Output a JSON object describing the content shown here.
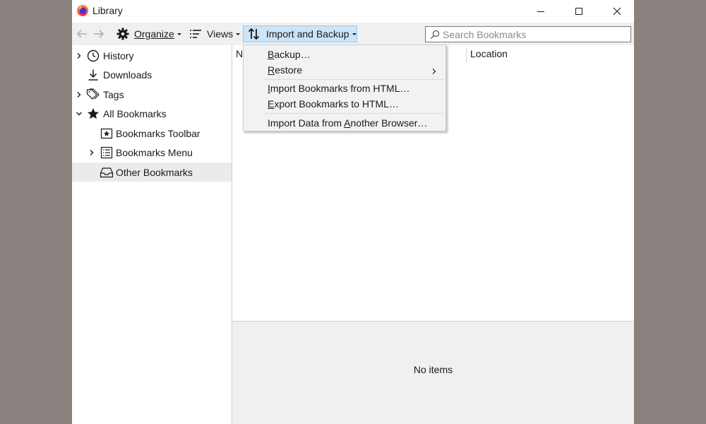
{
  "window": {
    "title": "Library"
  },
  "toolbar": {
    "organize_label": "Organize",
    "views_label": "Views",
    "import_backup_label": "Import and Backup",
    "search_placeholder": "Search Bookmarks"
  },
  "sidebar": {
    "items": [
      {
        "label": "History",
        "icon": "clock-icon",
        "expandable": true
      },
      {
        "label": "Downloads",
        "icon": "download-icon",
        "expandable": false
      },
      {
        "label": "Tags",
        "icon": "tag-icon",
        "expandable": true
      },
      {
        "label": "All Bookmarks",
        "icon": "star-icon",
        "expandable": true,
        "expanded": true
      },
      {
        "label": "Bookmarks Toolbar",
        "icon": "bookmarks-toolbar-icon",
        "expandable": false
      },
      {
        "label": "Bookmarks Menu",
        "icon": "bookmarks-menu-icon",
        "expandable": true
      },
      {
        "label": "Other Bookmarks",
        "icon": "other-bookmarks-icon",
        "expandable": false,
        "selected": true
      }
    ]
  },
  "list": {
    "columns": [
      "N",
      "Location"
    ]
  },
  "details": {
    "empty_text": "No items"
  },
  "menu": {
    "items": [
      {
        "pre": "",
        "accel": "B",
        "post": "ackup…"
      },
      {
        "pre": "",
        "accel": "R",
        "post": "estore",
        "submenu": true
      },
      {
        "pre": "",
        "accel": "I",
        "post": "mport Bookmarks from HTML…"
      },
      {
        "pre": "",
        "accel": "E",
        "post": "xport Bookmarks to HTML…"
      },
      {
        "pre": "Import Data from ",
        "accel": "A",
        "post": "nother Browser…"
      }
    ]
  },
  "colors": {
    "accent_active": "#cce4f7",
    "backdrop": "#8b817e",
    "selected_row": "#ebebeb"
  }
}
